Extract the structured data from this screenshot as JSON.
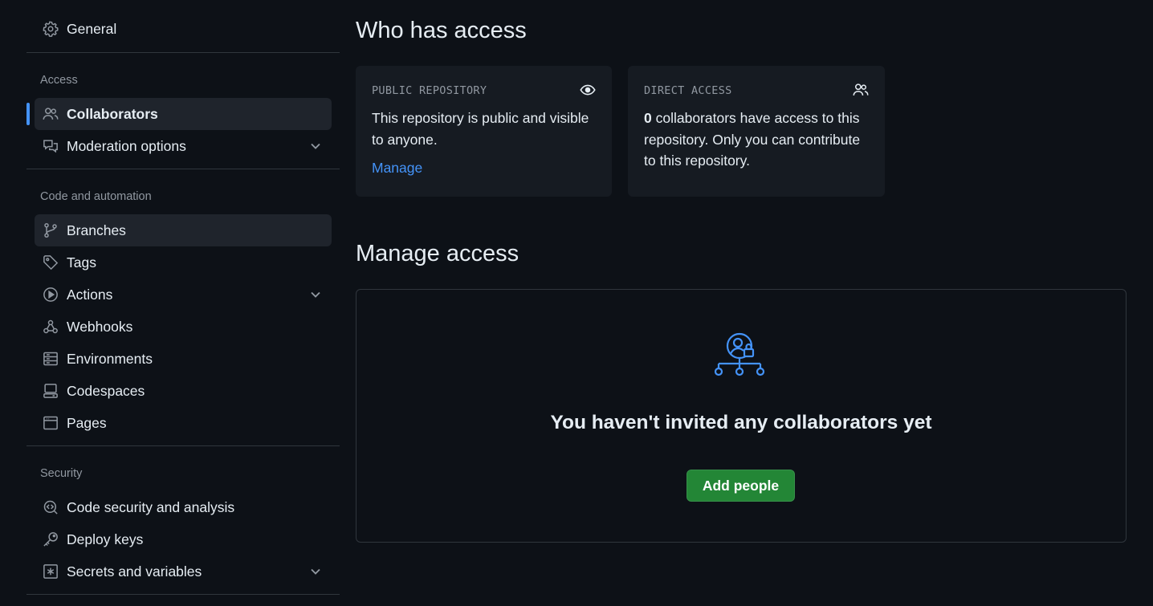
{
  "sidebar": {
    "top_item": {
      "label": "General",
      "icon": "gear-icon"
    },
    "groups": [
      {
        "heading": "Access",
        "items": [
          {
            "label": "Collaborators",
            "icon": "people-icon",
            "selected": true
          },
          {
            "label": "Moderation options",
            "icon": "comment-discussion-icon",
            "expandable": true
          }
        ]
      },
      {
        "heading": "Code and automation",
        "items": [
          {
            "label": "Branches",
            "icon": "git-branch-icon",
            "hovered": true
          },
          {
            "label": "Tags",
            "icon": "tag-icon"
          },
          {
            "label": "Actions",
            "icon": "play-icon",
            "expandable": true
          },
          {
            "label": "Webhooks",
            "icon": "webhook-icon"
          },
          {
            "label": "Environments",
            "icon": "server-icon"
          },
          {
            "label": "Codespaces",
            "icon": "codespaces-icon"
          },
          {
            "label": "Pages",
            "icon": "browser-icon"
          }
        ]
      },
      {
        "heading": "Security",
        "items": [
          {
            "label": "Code security and analysis",
            "icon": "codescan-icon"
          },
          {
            "label": "Deploy keys",
            "icon": "key-icon"
          },
          {
            "label": "Secrets and variables",
            "icon": "asterisk-icon",
            "expandable": true
          }
        ]
      }
    ]
  },
  "main": {
    "who_has_access": {
      "title": "Who has access",
      "public_card": {
        "label": "PUBLIC REPOSITORY",
        "icon": "eye-icon",
        "text": "This repository is public and visible to anyone.",
        "link": "Manage"
      },
      "direct_card": {
        "label": "DIRECT ACCESS",
        "icon": "people-icon",
        "count": "0",
        "text": " collaborators have access to this repository. Only you can contribute to this repository."
      }
    },
    "manage_access": {
      "title": "Manage access",
      "empty_icon": "collaborators-lock-icon",
      "empty_title": "You haven't invited any collaborators yet",
      "button": "Add people"
    }
  },
  "colors": {
    "background": "#0d1117",
    "card_background": "#161b22",
    "accent": "#4493f8",
    "primary_button": "#238636",
    "border": "#30363d"
  }
}
